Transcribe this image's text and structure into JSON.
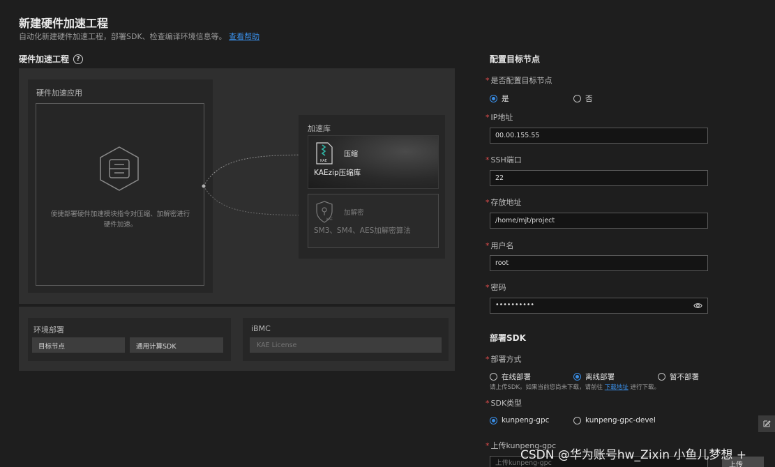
{
  "header": {
    "title": "新建硬件加速工程",
    "subtitle": "自动化新建硬件加速工程，部署SDK、检查编译环境信息等。",
    "help_link": "查看帮助"
  },
  "project": {
    "section_title": "硬件加速工程",
    "app_panel": {
      "title": "硬件加速应用",
      "description": "便捷部署硬件加速模块指令对压缩、加解密进行硬件加速。"
    },
    "library": {
      "title": "加速库",
      "cards": [
        {
          "name": "压缩",
          "desc": "KAEzip压缩库",
          "icon": "kae-zip-icon",
          "active": true
        },
        {
          "name": "加解密",
          "desc": "SM3、SM4、AES加解密算法",
          "icon": "kae-lock-icon",
          "active": false
        }
      ]
    },
    "env": {
      "title": "环境部署",
      "buttons": [
        "目标节点",
        "通用计算SDK"
      ]
    },
    "ibmc": {
      "title": "iBMC",
      "placeholder": "KAE License"
    }
  },
  "target_node": {
    "title": "配置目标节点",
    "configure_label": "是否配置目标节点",
    "configure_options": [
      "是",
      "否"
    ],
    "configure_selected": "是",
    "ip_label": "IP地址",
    "ip_value": "00.00.155.55",
    "ssh_label": "SSH端口",
    "ssh_value": "22",
    "path_label": "存放地址",
    "path_value": "/home/mjt/project",
    "user_label": "用户名",
    "user_value": "root",
    "password_label": "密码",
    "password_value": "••••••••••"
  },
  "sdk": {
    "title": "部署SDK",
    "mode_label": "部署方式",
    "mode_options": [
      "在线部署",
      "离线部署",
      "暂不部署"
    ],
    "mode_selected": "离线部署",
    "hint": "请上传SDK。如果当前您尚未下载，请前往",
    "hint_link": "下载地址",
    "hint_suffix": "进行下载。",
    "type_label": "SDK类型",
    "type_options": [
      "kunpeng-gpc",
      "kunpeng-gpc-devel"
    ],
    "type_selected": "kunpeng-gpc",
    "upload_label": "上传kunpeng-gpc",
    "upload_placeholder": "上传kunpeng-gpc",
    "upload_button": "上传"
  },
  "watermark": "CSDN @华为账号hw_Zixin 小鱼儿梦想 +",
  "colors": {
    "accent": "#3a8ee6",
    "required": "#e34d4d",
    "background": "#1e1e1e"
  }
}
